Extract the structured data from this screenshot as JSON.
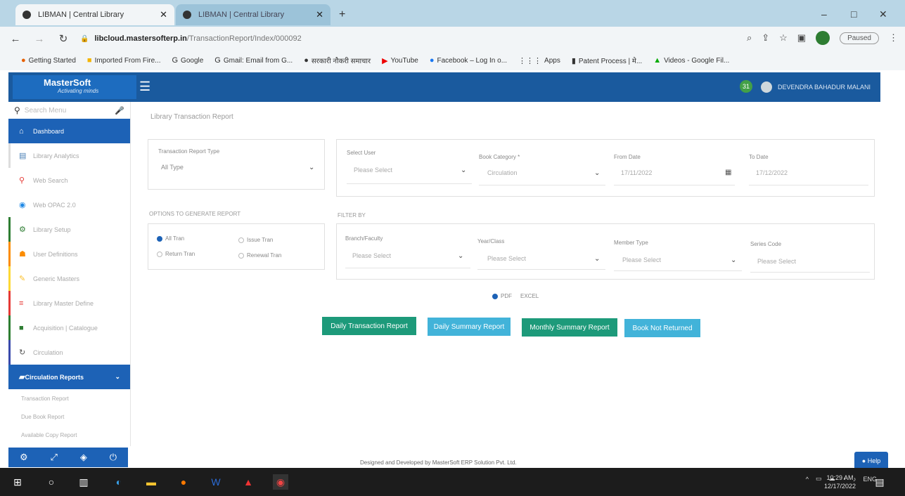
{
  "browser": {
    "tabs": [
      {
        "label": "LIBMAN | Central Library",
        "active": true
      },
      {
        "label": "LIBMAN | Central Library",
        "active": false
      }
    ],
    "url_host": "libcloud.mastersofterp.in",
    "url_path": "/TransactionReport/Index/000092",
    "paused_label": "Paused",
    "bookmarks": [
      {
        "label": "Getting Started",
        "icon": "firefox-icon"
      },
      {
        "label": "Imported From Fire...",
        "icon": "folder-icon"
      },
      {
        "label": "Google",
        "icon": "google-icon"
      },
      {
        "label": "Gmail: Email from G...",
        "icon": "google-icon"
      },
      {
        "label": "सरकारी नौकरी समाचार",
        "icon": "globe-icon"
      },
      {
        "label": "YouTube",
        "icon": "youtube-icon"
      },
      {
        "label": "Facebook – Log In o...",
        "icon": "facebook-icon"
      },
      {
        "label": "Apps",
        "icon": "apps-icon"
      },
      {
        "label": "Patent Process | मे...",
        "icon": "bookmark-icon"
      },
      {
        "label": "Videos - Google Fil...",
        "icon": "video-icon"
      }
    ]
  },
  "app": {
    "logo_name": "MasterSoft",
    "logo_tagline": "Activating minds",
    "notif_count": "31",
    "user_name": "DEVENDRA BAHADUR MALANI"
  },
  "sidebar": {
    "search_placeholder": "Search Menu",
    "items": [
      {
        "label": "Dashboard",
        "icon": "home-icon"
      },
      {
        "label": "Library Analytics",
        "icon": "chart-icon"
      },
      {
        "label": "Web Search",
        "icon": "search-icon"
      },
      {
        "label": "Web OPAC 2.0",
        "icon": "globe-icon"
      },
      {
        "label": "Library Setup",
        "icon": "gear-icon"
      },
      {
        "label": "User Definitions",
        "icon": "users-icon"
      },
      {
        "label": "Generic Masters",
        "icon": "pencil-icon"
      },
      {
        "label": "Library Master Define",
        "icon": "list-icon"
      },
      {
        "label": "Acquisition | Catalogue",
        "icon": "book-icon"
      },
      {
        "label": "Circulation",
        "icon": "refresh-icon"
      }
    ],
    "active_group": "Circulation Reports",
    "sub_items": [
      "Transaction Report",
      "Due Book Report",
      "Available Copy Report"
    ]
  },
  "page": {
    "title": "Library Transaction Report",
    "transaction_type_label": "Transaction Report Type",
    "transaction_type_value": "All Type",
    "select_user_label": "Select User",
    "select_user_value": "Please Select",
    "book_category_label": "Book Category *",
    "book_category_value": "Circulation",
    "from_date_label": "From Date",
    "from_date_value": "17/11/2022",
    "to_date_label": "To Date",
    "to_date_value": "17/12/2022",
    "options_label": "OPTIONS TO GENERATE REPORT",
    "filter_label": "FILTER BY",
    "radios": [
      {
        "label": "All Tran",
        "checked": true
      },
      {
        "label": "Issue Tran",
        "checked": false
      },
      {
        "label": "Return Tran",
        "checked": false
      },
      {
        "label": "Renewal Tran",
        "checked": false
      }
    ],
    "branch_label": "Branch/Faculty",
    "branch_value": "Please Select",
    "year_label": "Year/Class",
    "year_value": "Please Select",
    "member_type_label": "Member Type",
    "member_type_value": "Please Select",
    "series_code_label": "Series Code",
    "series_code_value": "Please Select",
    "format_pdf": "PDF",
    "format_excel": "EXCEL",
    "buttons": [
      "Daily Transaction Report",
      "Daily Summary Report",
      "Monthly Summary Report",
      "Book Not Returned"
    ],
    "footer": "Designed and Developed by MasterSoft ERP Solution Pvt. Ltd.",
    "help": "Help"
  },
  "taskbar": {
    "lang": "ENG",
    "time": "10:29 AM",
    "date": "12/17/2022"
  }
}
